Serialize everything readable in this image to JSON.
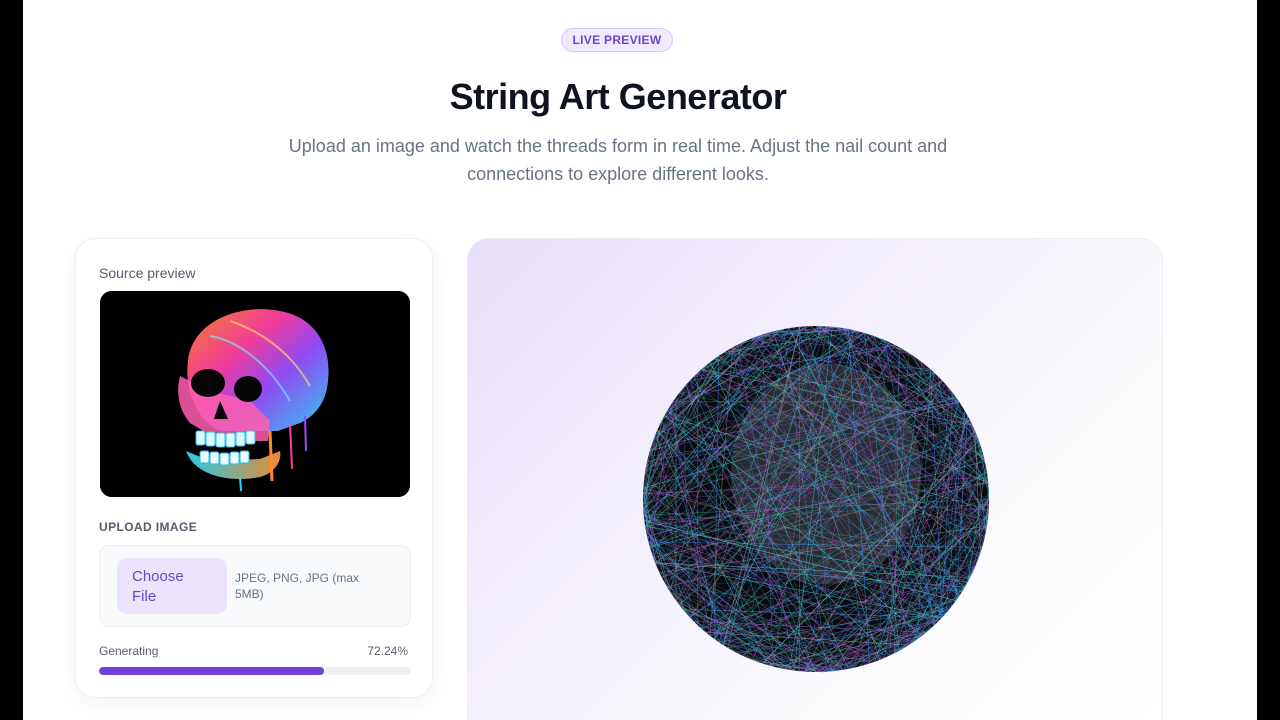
{
  "header": {
    "badge": "LIVE PREVIEW",
    "title": "String Art Generator",
    "subtitle": "Upload an image and watch the threads form in real time. Adjust the nail count and connections to explore different looks."
  },
  "controls": {
    "source_label": "Source preview",
    "upload_label": "UPLOAD IMAGE",
    "choose_button": "Choose File",
    "upload_hint": "JPEG, PNG, JPG (max 5MB)",
    "progress_label": "Generating",
    "progress_text": "72.24%",
    "progress_value": 72.24
  },
  "colors": {
    "accent": "#6f3fd8",
    "thread_colors": [
      "#2fd6c8",
      "#b04ae0",
      "#3a9bff",
      "#9aa0a8"
    ]
  },
  "icons": {
    "source_image": "skull-artwork-image"
  }
}
